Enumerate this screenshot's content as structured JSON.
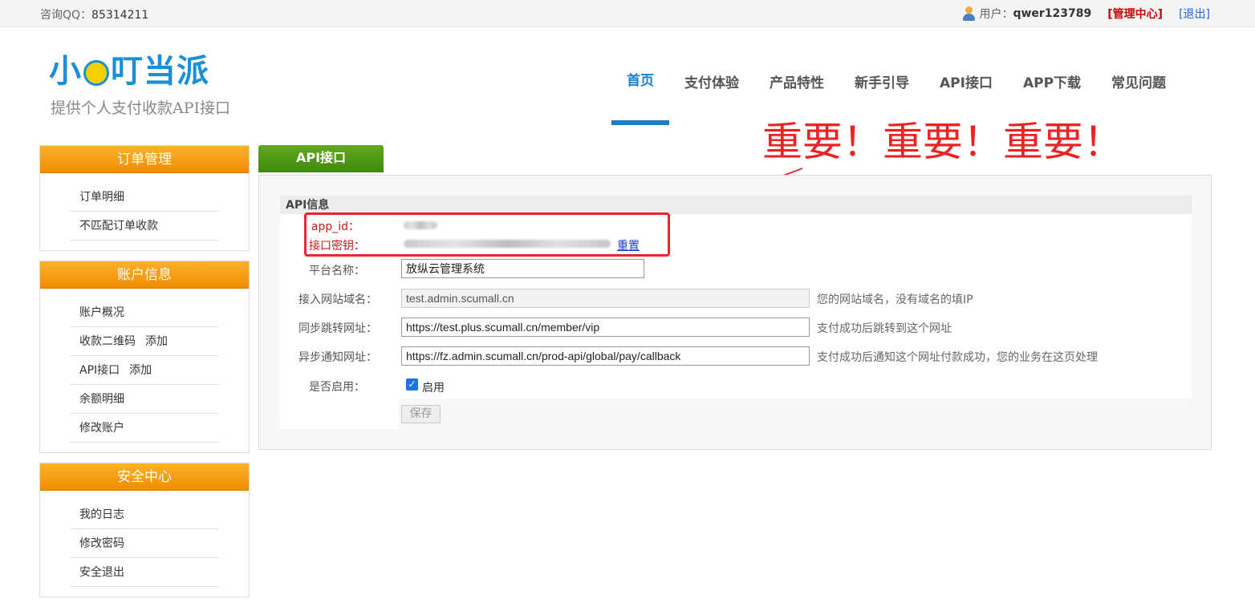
{
  "topbar": {
    "qq_label": "咨询QQ：",
    "qq_number": "85314211",
    "user_prefix": "用户：",
    "username": "qwer123789",
    "admin_center": "[管理中心]",
    "logout": "[退出]"
  },
  "header": {
    "logo_text_1": "小",
    "logo_text_2": "叮当派",
    "slogan": "提供个人支付收款API接口"
  },
  "nav": {
    "items": [
      "首页",
      "支付体验",
      "产品特性",
      "新手引导",
      "API接口",
      "APP下载",
      "常见问题"
    ],
    "active_index": 0
  },
  "annotation": {
    "text": "重要！重要！重要！",
    "color": "#ee2222"
  },
  "sidebar": {
    "sections": [
      {
        "title": "订单管理",
        "items": [
          {
            "label": "订单明细"
          },
          {
            "label": "不匹配订单收款"
          }
        ]
      },
      {
        "title": "账户信息",
        "items": [
          {
            "label": "账户概况"
          },
          {
            "label": "收款二维码",
            "extra": "添加"
          },
          {
            "label": "API接口",
            "extra": "添加"
          },
          {
            "label": "余额明细"
          },
          {
            "label": "修改账户"
          }
        ]
      },
      {
        "title": "安全中心",
        "items": [
          {
            "label": "我的日志"
          },
          {
            "label": "修改密码"
          },
          {
            "label": "安全退出"
          }
        ]
      }
    ],
    "header_color": "#f59a0c"
  },
  "main": {
    "tab_label": "API接口",
    "section_title": "API信息",
    "app_id_label": "app_id：",
    "secret_label": "接口密钥：",
    "reset_label": "重置",
    "platform_label": "平台名称：",
    "platform_value": "放纵云管理系统",
    "domain_label": "接入网站域名：",
    "domain_value": "test.admin.scumall.cn",
    "domain_hint": "您的网站域名，没有域名的填IP",
    "sync_label": "同步跳转网址：",
    "sync_value": "https://test.plus.scumall.cn/member/vip",
    "sync_hint": "支付成功后跳转到这个网址",
    "async_label": "异步通知网址：",
    "async_value": "https://fz.admin.scumall.cn/prod-api/global/pay/callback",
    "async_hint": "支付成功后通知这个网址付款成功，您的业务在这页处理",
    "enable_label": "是否启用：",
    "enable_checked": true,
    "enable_text": "启用",
    "save_label": "保存",
    "tab_color": "#4f9a17"
  }
}
